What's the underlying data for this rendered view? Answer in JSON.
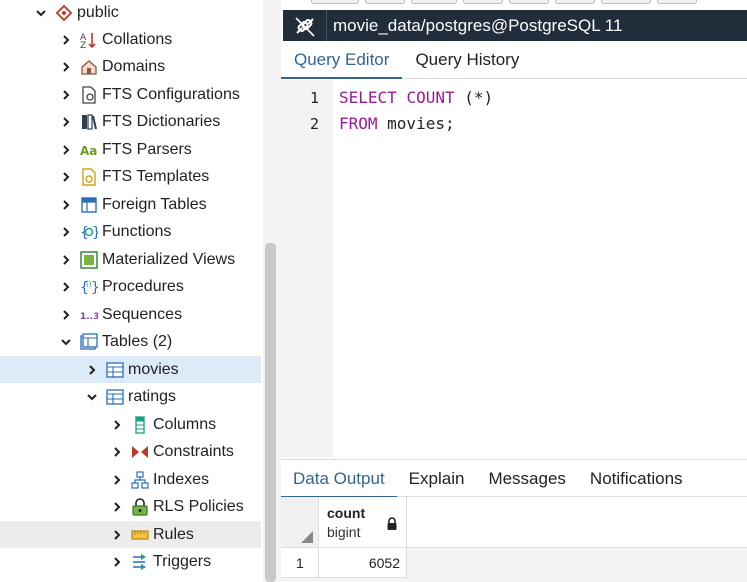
{
  "tree": {
    "items": [
      {
        "label": "public",
        "icon": "schema-icon",
        "expanded": true
      },
      {
        "label": "Collations",
        "icon": "collation-icon"
      },
      {
        "label": "Domains",
        "icon": "domain-icon"
      },
      {
        "label": "FTS Configurations",
        "icon": "fts-config-icon"
      },
      {
        "label": "FTS Dictionaries",
        "icon": "fts-dictionary-icon"
      },
      {
        "label": "FTS Parsers",
        "icon": "fts-parser-icon",
        "icon_text": "Aa"
      },
      {
        "label": "FTS Templates",
        "icon": "fts-template-icon"
      },
      {
        "label": "Foreign Tables",
        "icon": "foreign-table-icon"
      },
      {
        "label": "Functions",
        "icon": "function-icon"
      },
      {
        "label": "Materialized Views",
        "icon": "materialized-view-icon"
      },
      {
        "label": "Procedures",
        "icon": "procedure-icon"
      },
      {
        "label": "Sequences",
        "icon": "sequence-icon",
        "icon_text": "1..3"
      },
      {
        "label": "Tables (2)",
        "icon": "tables-icon",
        "expanded": true
      },
      {
        "label": "movies",
        "icon": "table-icon",
        "selected": true
      },
      {
        "label": "ratings",
        "icon": "table-icon",
        "expanded": true
      },
      {
        "label": "Columns",
        "icon": "columns-icon"
      },
      {
        "label": "Constraints",
        "icon": "constraints-icon"
      },
      {
        "label": "Indexes",
        "icon": "indexes-icon"
      },
      {
        "label": "RLS Policies",
        "icon": "rls-policy-icon"
      },
      {
        "label": "Rules",
        "icon": "rules-icon"
      },
      {
        "label": "Triggers",
        "icon": "triggers-icon"
      }
    ]
  },
  "connection": {
    "title": "movie_data/postgres@PostgreSQL 11",
    "bar_color": "#222d3b"
  },
  "editor_tabs": [
    "Query Editor",
    "Query History"
  ],
  "editor": {
    "line_numbers": [
      "1",
      "2"
    ],
    "lines": [
      {
        "kw1": "SELECT",
        "kw2": "COUNT",
        "rest": " (*)"
      },
      {
        "kw1": "FROM",
        "rest": " movies;"
      }
    ],
    "keyword_color": "#9b1a9b"
  },
  "output_tabs": [
    "Data Output",
    "Explain",
    "Messages",
    "Notifications"
  ],
  "grid": {
    "column": {
      "name": "count",
      "type": "bigint"
    },
    "rows": [
      {
        "num": "1",
        "value": "6052"
      }
    ]
  },
  "colors": {
    "accent": "#326690",
    "selected_row": "#dcebf7"
  }
}
